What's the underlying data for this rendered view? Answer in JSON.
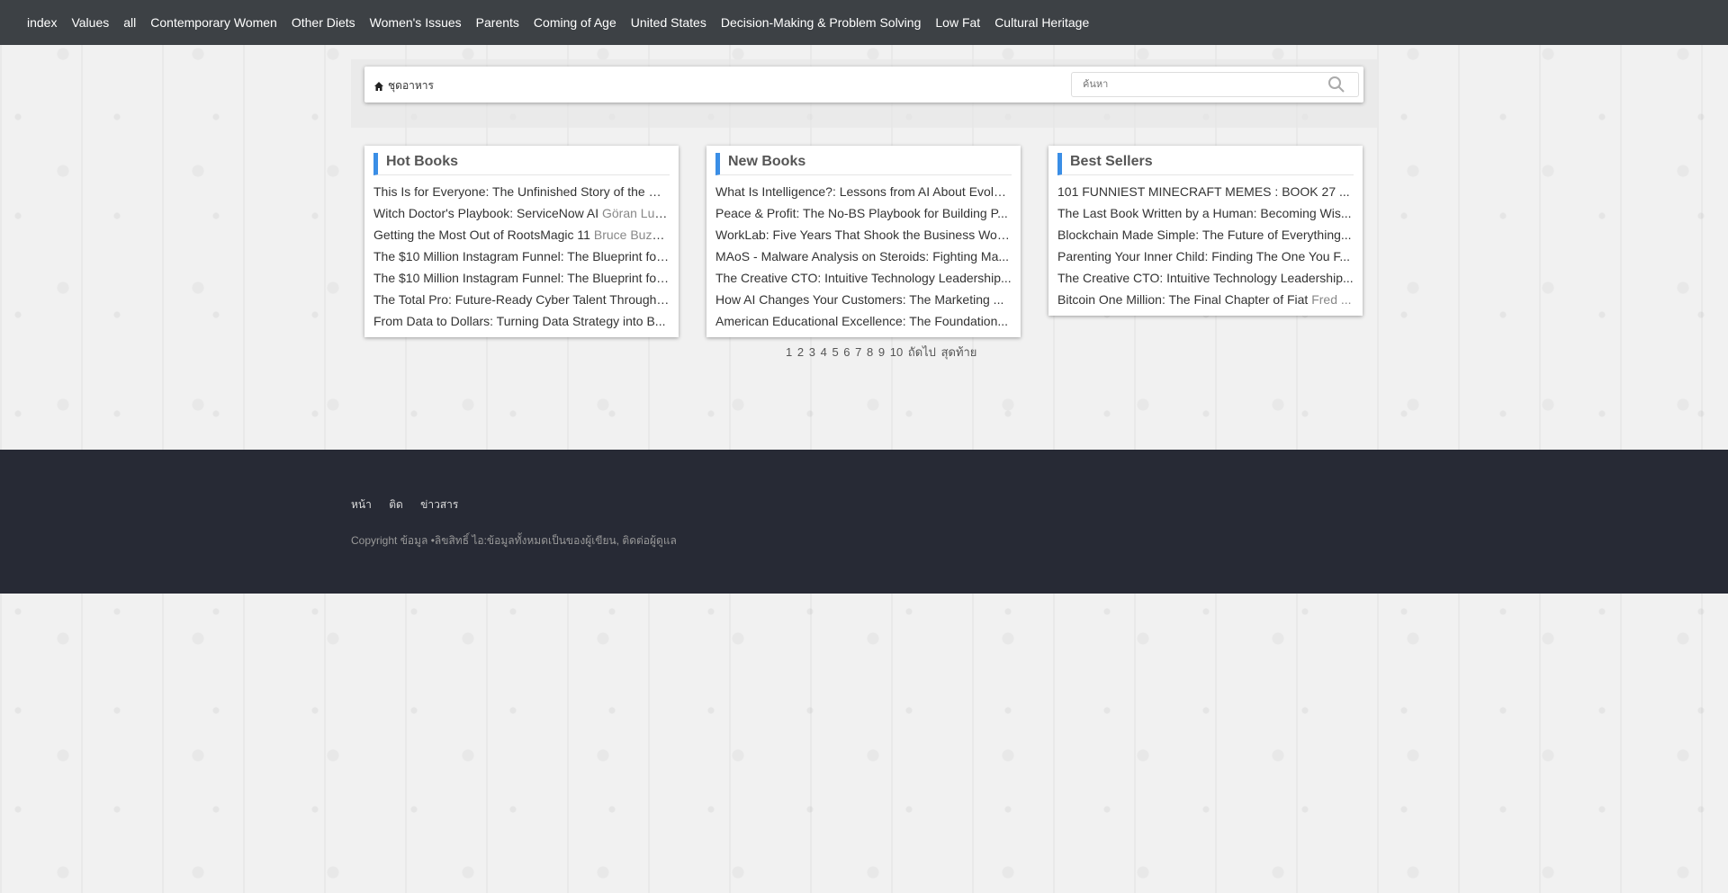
{
  "topnav": [
    "index",
    "Values",
    "all",
    "Contemporary Women",
    "Other Diets",
    "Women's Issues",
    "Parents",
    "Coming of Age",
    "United States",
    "Decision-Making & Problem Solving",
    "Low Fat",
    "Cultural Heritage"
  ],
  "searchbar": {
    "home_label": "ชุดอาหาร",
    "placeholder": "ค้นหา"
  },
  "panels": [
    {
      "title": "Hot Books",
      "items": [
        {
          "title": "This Is for Everyone: The Unfinished Story of the World Wide Web",
          "author": ""
        },
        {
          "title": "Witch Doctor's Playbook: ServiceNow AI",
          "author": "Göran Lundqvist"
        },
        {
          "title": "Getting the Most Out of RootsMagic 11",
          "author": "Bruce Buzbee"
        },
        {
          "title": "The $10 Million Instagram Funnel: The Blueprint for ...",
          "author": ""
        },
        {
          "title": "The $10 Million Instagram Funnel: The Blueprint for ...",
          "author": ""
        },
        {
          "title": "The Total Pro: Future-Ready Cyber Talent Through ...",
          "author": ""
        },
        {
          "title": "From Data to Dollars: Turning Data Strategy into B...",
          "author": ""
        }
      ]
    },
    {
      "title": "New Books",
      "items": [
        {
          "title": "What Is Intelligence?: Lessons from AI About Evolution...",
          "author": ""
        },
        {
          "title": "Peace & Profit: The No-BS Playbook for Building P...",
          "author": ""
        },
        {
          "title": "WorkLab: Five Years That Shook the Business World...",
          "author": ""
        },
        {
          "title": "MAoS - Malware Analysis on Steroids: Fighting Ma...",
          "author": ""
        },
        {
          "title": "The Creative CTO: Intuitive Technology Leadership...",
          "author": ""
        },
        {
          "title": "How AI Changes Your Customers: The Marketing ...",
          "author": ""
        },
        {
          "title": "American Educational Excellence: The Foundation...",
          "author": ""
        }
      ]
    },
    {
      "title": "Best Sellers",
      "items": [
        {
          "title": "101 FUNNIEST MINECRAFT MEMES : BOOK 27 ...",
          "author": ""
        },
        {
          "title": "The Last Book Written by a Human: Becoming Wis...",
          "author": ""
        },
        {
          "title": "Blockchain Made Simple: The Future of Everything...",
          "author": ""
        },
        {
          "title": "Parenting Your Inner Child: Finding The One You F...",
          "author": ""
        },
        {
          "title": "The Creative CTO: Intuitive Technology Leadership...",
          "author": ""
        },
        {
          "title": "Bitcoin One Million: The Final Chapter of Fiat",
          "author": "Fred ..."
        }
      ]
    }
  ],
  "pager": [
    "1",
    "2",
    "3",
    "4",
    "5",
    "6",
    "7",
    "8",
    "9",
    "10",
    "ถัดไป",
    "สุดท้าย"
  ],
  "footer": {
    "links": [
      "หน้า",
      "ติด",
      "ข่าวสาร"
    ],
    "copyright": "Copyright ข้อมูล •ลิขสิทธิ์ ไอ:ข้อมูลทั้งหมดเป็นของผู้เขียน, ติดต่อผู้ดูแล"
  }
}
